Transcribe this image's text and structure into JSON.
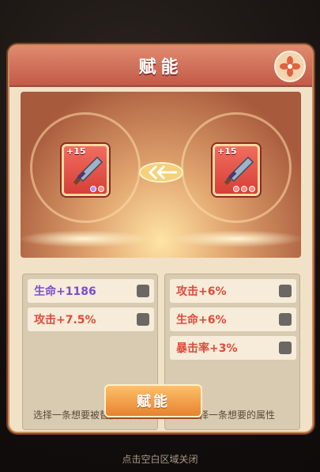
{
  "title": "赋能",
  "left_item": {
    "level": "+15"
  },
  "right_item": {
    "level": "+15"
  },
  "left_attributes": [
    {
      "label": "生命+1186",
      "color": "#7b4dd0"
    },
    {
      "label": "攻击+7.5%",
      "color": "#e04a3a"
    }
  ],
  "right_attributes": [
    {
      "label": "攻击+6%",
      "color": "#e04a3a"
    },
    {
      "label": "生命+6%",
      "color": "#e04a3a"
    },
    {
      "label": "暴击率+3%",
      "color": "#e04a3a"
    }
  ],
  "left_hint": "选择一条想要被替换的属性",
  "right_hint": "选择一条想要的属性",
  "confirm_button": "赋能",
  "footer_hint": "点击空白区域关闭",
  "colors": {
    "accent": "#c25a48",
    "button": "#e6822e"
  }
}
